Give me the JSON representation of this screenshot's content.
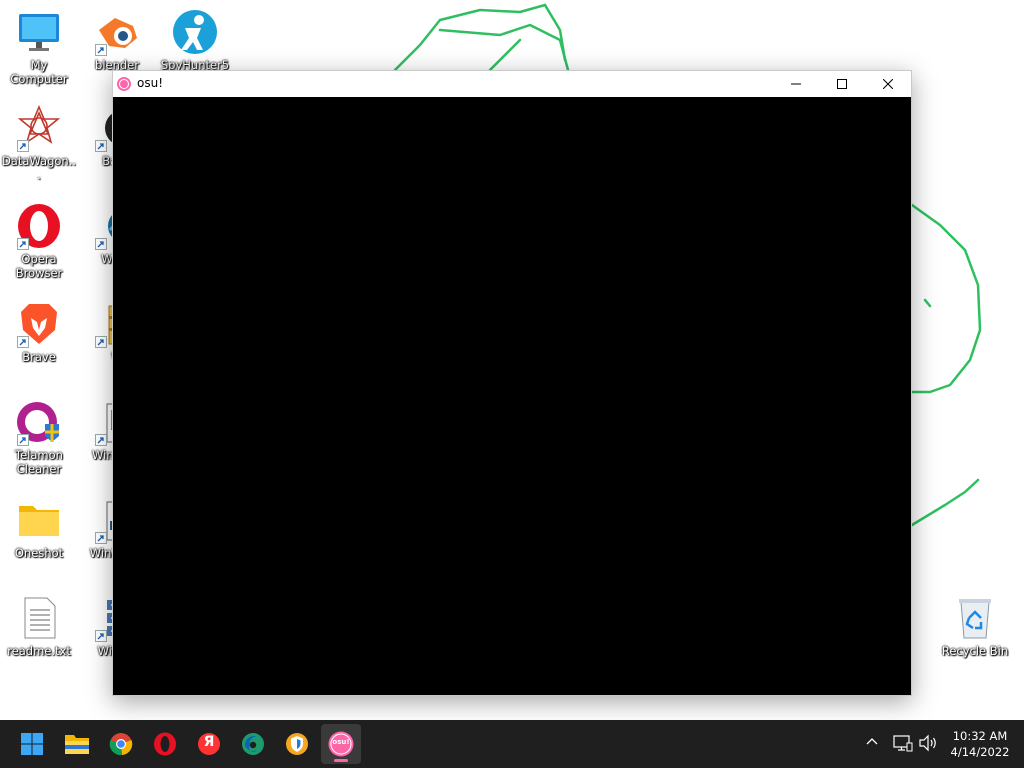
{
  "desktop": {
    "icons": [
      {
        "name": "my-computer",
        "label": "My Computer"
      },
      {
        "name": "blender",
        "label": "blender"
      },
      {
        "name": "spyhunter",
        "label": "SpyHunter5"
      },
      {
        "name": "datawagon",
        "label": "DataWagon..."
      },
      {
        "name": "bandicam",
        "label": "Band"
      },
      {
        "name": "opera",
        "label": "Opera Browser"
      },
      {
        "name": "wave",
        "label": "Wave"
      },
      {
        "name": "brave",
        "label": "Brave"
      },
      {
        "name": "winrar",
        "label": "W"
      },
      {
        "name": "telamon",
        "label": "Telamon Cleaner"
      },
      {
        "name": "winzip-media",
        "label": "WinZ Ma"
      },
      {
        "name": "oneshot",
        "label": "Oneshot"
      },
      {
        "name": "winzip-pdf",
        "label": "WinZ Exp"
      },
      {
        "name": "readme",
        "label": "readme.txt"
      },
      {
        "name": "winzip-secure",
        "label": "Wi Sec"
      },
      {
        "name": "recycle-bin",
        "label": "Recycle Bin"
      }
    ]
  },
  "window": {
    "title": "osu!",
    "icon": "osu-icon",
    "buttons": {
      "minimize": "minimize-icon",
      "maximize": "maximize-icon",
      "close": "close-icon"
    },
    "canvas_color": "#000000"
  },
  "taskbar": {
    "apps": [
      {
        "name": "start",
        "icon": "windows-icon"
      },
      {
        "name": "file-explorer",
        "icon": "folder-icon"
      },
      {
        "name": "chrome",
        "icon": "chrome-icon"
      },
      {
        "name": "opera",
        "icon": "opera-icon"
      },
      {
        "name": "yandex",
        "icon": "yandex-icon",
        "glyph": "Я"
      },
      {
        "name": "edge",
        "icon": "edge-icon"
      },
      {
        "name": "vpn",
        "icon": "vpn-shield-icon"
      },
      {
        "name": "osu",
        "icon": "osu-icon",
        "glyph": "osu!",
        "active": true
      }
    ],
    "tray": {
      "time": "10:32 AM",
      "date": "4/14/2022"
    }
  },
  "colors": {
    "osu_pink": "#ff66aa",
    "wallpaper_stroke": "#2ecc71",
    "taskbar_bg": "#1f1f1f"
  }
}
